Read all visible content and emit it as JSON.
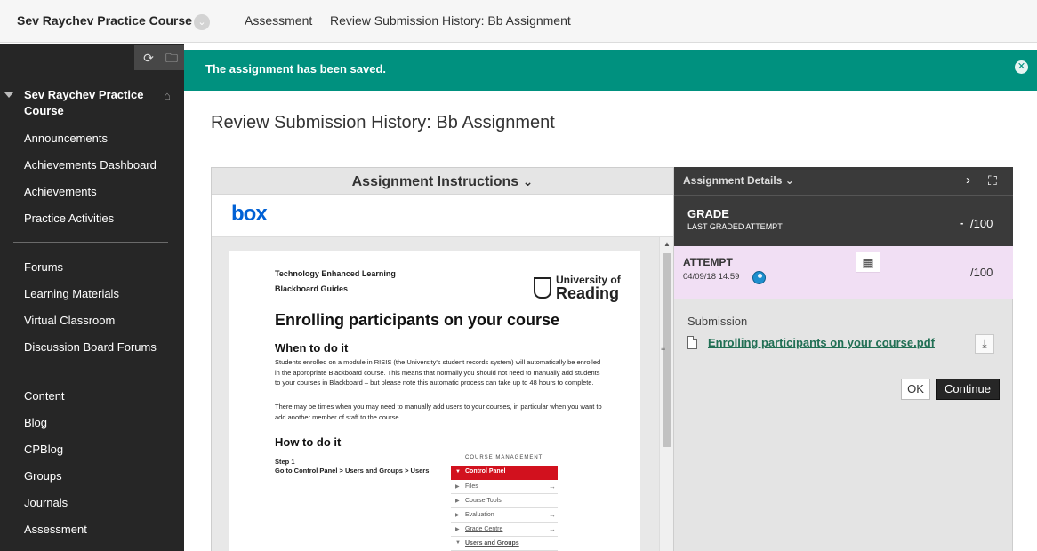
{
  "topbar": {
    "course_title": "Sev Raychev Practice Course",
    "chevron": "⌄",
    "crumbs": [
      "Assessment",
      "Review Submission History: Bb Assignment"
    ]
  },
  "sidebar": {
    "tools": {
      "refresh_icon": "⟳",
      "folder_icon": "🗀"
    },
    "course_name": "Sev Raychev Practice Course",
    "home_icon": "⌂",
    "group1": [
      "Announcements",
      "Achievements Dashboard",
      "Achievements",
      "Practice Activities"
    ],
    "group2": [
      "Forums",
      "Learning Materials",
      "Virtual Classroom",
      "Discussion Board Forums"
    ],
    "group3": [
      "Content",
      "Blog",
      "CPBlog",
      "Groups",
      "Journals",
      "Assessment"
    ]
  },
  "banner": {
    "text": "The assignment has been saved.",
    "close": "✕",
    "color": "#00917f"
  },
  "page_title": "Review Submission History: Bb Assignment",
  "instructions": {
    "heading": "Assignment Instructions",
    "heading_chevron": "⌄",
    "box_logo": "box",
    "scroll_up": "▲",
    "scroll_grip": "≡",
    "document": {
      "header1": "Technology Enhanced Learning",
      "header2": "Blackboard Guides",
      "uni_line1": "University of",
      "uni_line2": "Reading",
      "title": "Enrolling participants on your course",
      "when_heading": "When to do it",
      "when_p1": "Students enrolled on a module in RISIS (the University's student records system) will automatically be enrolled in the appropriate Blackboard course. This means that normally you should not need to manually add students to your courses in Blackboard – but please note this automatic process can take up to 48 hours to complete.",
      "when_p2": "There may be times when you may need to manually add users to your courses, in particular when you want to add another member of staff to the course.",
      "how_heading": "How to do it",
      "step": "Step 1",
      "step_desc": "Go to Control Panel > Users and Groups > Users",
      "cm_title": "COURSE MANAGEMENT",
      "cm_panel": "Control Panel",
      "cm_caret": "▼",
      "cm_items": [
        {
          "label": "Files",
          "caret": "▶",
          "arrow": "→"
        },
        {
          "label": "Course Tools",
          "caret": "▶",
          "arrow": ""
        },
        {
          "label": "Evaluation",
          "caret": "▶",
          "arrow": "→"
        },
        {
          "label": "Grade Centre",
          "caret": "▶",
          "arrow": "→"
        },
        {
          "label": "Users and Groups",
          "caret": "▼",
          "arrow": ""
        }
      ]
    }
  },
  "details": {
    "heading": "Assignment Details",
    "heading_chevron": "⌄",
    "next_icon": "›",
    "expand_icon": "⛶",
    "grade": {
      "label": "GRADE",
      "sub": "LAST GRADED ATTEMPT",
      "value": "-",
      "out_of": "/100"
    },
    "attempt": {
      "label": "ATTEMPT",
      "date": "04/09/18 14:59",
      "grid_icon": "▦",
      "out_of": "/100"
    },
    "submission_label": "Submission",
    "file_name": "Enrolling participants on your course.pdf",
    "download_icon": "⤓",
    "ok": "OK",
    "continue": "Continue"
  }
}
